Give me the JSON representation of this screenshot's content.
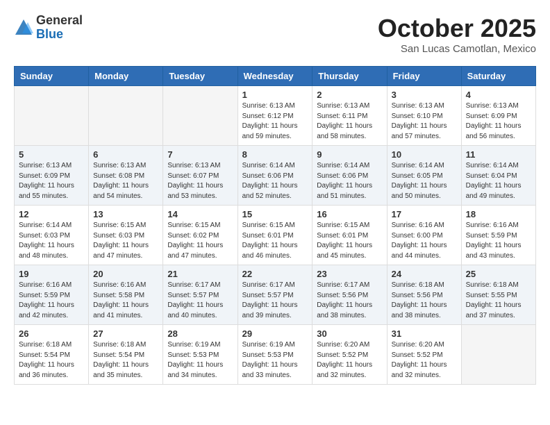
{
  "header": {
    "logo_general": "General",
    "logo_blue": "Blue",
    "month_title": "October 2025",
    "location": "San Lucas Camotlan, Mexico"
  },
  "days_of_week": [
    "Sunday",
    "Monday",
    "Tuesday",
    "Wednesday",
    "Thursday",
    "Friday",
    "Saturday"
  ],
  "weeks": [
    [
      {
        "day": "",
        "info": ""
      },
      {
        "day": "",
        "info": ""
      },
      {
        "day": "",
        "info": ""
      },
      {
        "day": "1",
        "info": "Sunrise: 6:13 AM\nSunset: 6:12 PM\nDaylight: 11 hours\nand 59 minutes."
      },
      {
        "day": "2",
        "info": "Sunrise: 6:13 AM\nSunset: 6:11 PM\nDaylight: 11 hours\nand 58 minutes."
      },
      {
        "day": "3",
        "info": "Sunrise: 6:13 AM\nSunset: 6:10 PM\nDaylight: 11 hours\nand 57 minutes."
      },
      {
        "day": "4",
        "info": "Sunrise: 6:13 AM\nSunset: 6:09 PM\nDaylight: 11 hours\nand 56 minutes."
      }
    ],
    [
      {
        "day": "5",
        "info": "Sunrise: 6:13 AM\nSunset: 6:09 PM\nDaylight: 11 hours\nand 55 minutes."
      },
      {
        "day": "6",
        "info": "Sunrise: 6:13 AM\nSunset: 6:08 PM\nDaylight: 11 hours\nand 54 minutes."
      },
      {
        "day": "7",
        "info": "Sunrise: 6:13 AM\nSunset: 6:07 PM\nDaylight: 11 hours\nand 53 minutes."
      },
      {
        "day": "8",
        "info": "Sunrise: 6:14 AM\nSunset: 6:06 PM\nDaylight: 11 hours\nand 52 minutes."
      },
      {
        "day": "9",
        "info": "Sunrise: 6:14 AM\nSunset: 6:06 PM\nDaylight: 11 hours\nand 51 minutes."
      },
      {
        "day": "10",
        "info": "Sunrise: 6:14 AM\nSunset: 6:05 PM\nDaylight: 11 hours\nand 50 minutes."
      },
      {
        "day": "11",
        "info": "Sunrise: 6:14 AM\nSunset: 6:04 PM\nDaylight: 11 hours\nand 49 minutes."
      }
    ],
    [
      {
        "day": "12",
        "info": "Sunrise: 6:14 AM\nSunset: 6:03 PM\nDaylight: 11 hours\nand 48 minutes."
      },
      {
        "day": "13",
        "info": "Sunrise: 6:15 AM\nSunset: 6:03 PM\nDaylight: 11 hours\nand 47 minutes."
      },
      {
        "day": "14",
        "info": "Sunrise: 6:15 AM\nSunset: 6:02 PM\nDaylight: 11 hours\nand 47 minutes."
      },
      {
        "day": "15",
        "info": "Sunrise: 6:15 AM\nSunset: 6:01 PM\nDaylight: 11 hours\nand 46 minutes."
      },
      {
        "day": "16",
        "info": "Sunrise: 6:15 AM\nSunset: 6:01 PM\nDaylight: 11 hours\nand 45 minutes."
      },
      {
        "day": "17",
        "info": "Sunrise: 6:16 AM\nSunset: 6:00 PM\nDaylight: 11 hours\nand 44 minutes."
      },
      {
        "day": "18",
        "info": "Sunrise: 6:16 AM\nSunset: 5:59 PM\nDaylight: 11 hours\nand 43 minutes."
      }
    ],
    [
      {
        "day": "19",
        "info": "Sunrise: 6:16 AM\nSunset: 5:59 PM\nDaylight: 11 hours\nand 42 minutes."
      },
      {
        "day": "20",
        "info": "Sunrise: 6:16 AM\nSunset: 5:58 PM\nDaylight: 11 hours\nand 41 minutes."
      },
      {
        "day": "21",
        "info": "Sunrise: 6:17 AM\nSunset: 5:57 PM\nDaylight: 11 hours\nand 40 minutes."
      },
      {
        "day": "22",
        "info": "Sunrise: 6:17 AM\nSunset: 5:57 PM\nDaylight: 11 hours\nand 39 minutes."
      },
      {
        "day": "23",
        "info": "Sunrise: 6:17 AM\nSunset: 5:56 PM\nDaylight: 11 hours\nand 38 minutes."
      },
      {
        "day": "24",
        "info": "Sunrise: 6:18 AM\nSunset: 5:56 PM\nDaylight: 11 hours\nand 38 minutes."
      },
      {
        "day": "25",
        "info": "Sunrise: 6:18 AM\nSunset: 5:55 PM\nDaylight: 11 hours\nand 37 minutes."
      }
    ],
    [
      {
        "day": "26",
        "info": "Sunrise: 6:18 AM\nSunset: 5:54 PM\nDaylight: 11 hours\nand 36 minutes."
      },
      {
        "day": "27",
        "info": "Sunrise: 6:18 AM\nSunset: 5:54 PM\nDaylight: 11 hours\nand 35 minutes."
      },
      {
        "day": "28",
        "info": "Sunrise: 6:19 AM\nSunset: 5:53 PM\nDaylight: 11 hours\nand 34 minutes."
      },
      {
        "day": "29",
        "info": "Sunrise: 6:19 AM\nSunset: 5:53 PM\nDaylight: 11 hours\nand 33 minutes."
      },
      {
        "day": "30",
        "info": "Sunrise: 6:20 AM\nSunset: 5:52 PM\nDaylight: 11 hours\nand 32 minutes."
      },
      {
        "day": "31",
        "info": "Sunrise: 6:20 AM\nSunset: 5:52 PM\nDaylight: 11 hours\nand 32 minutes."
      },
      {
        "day": "",
        "info": ""
      }
    ]
  ]
}
